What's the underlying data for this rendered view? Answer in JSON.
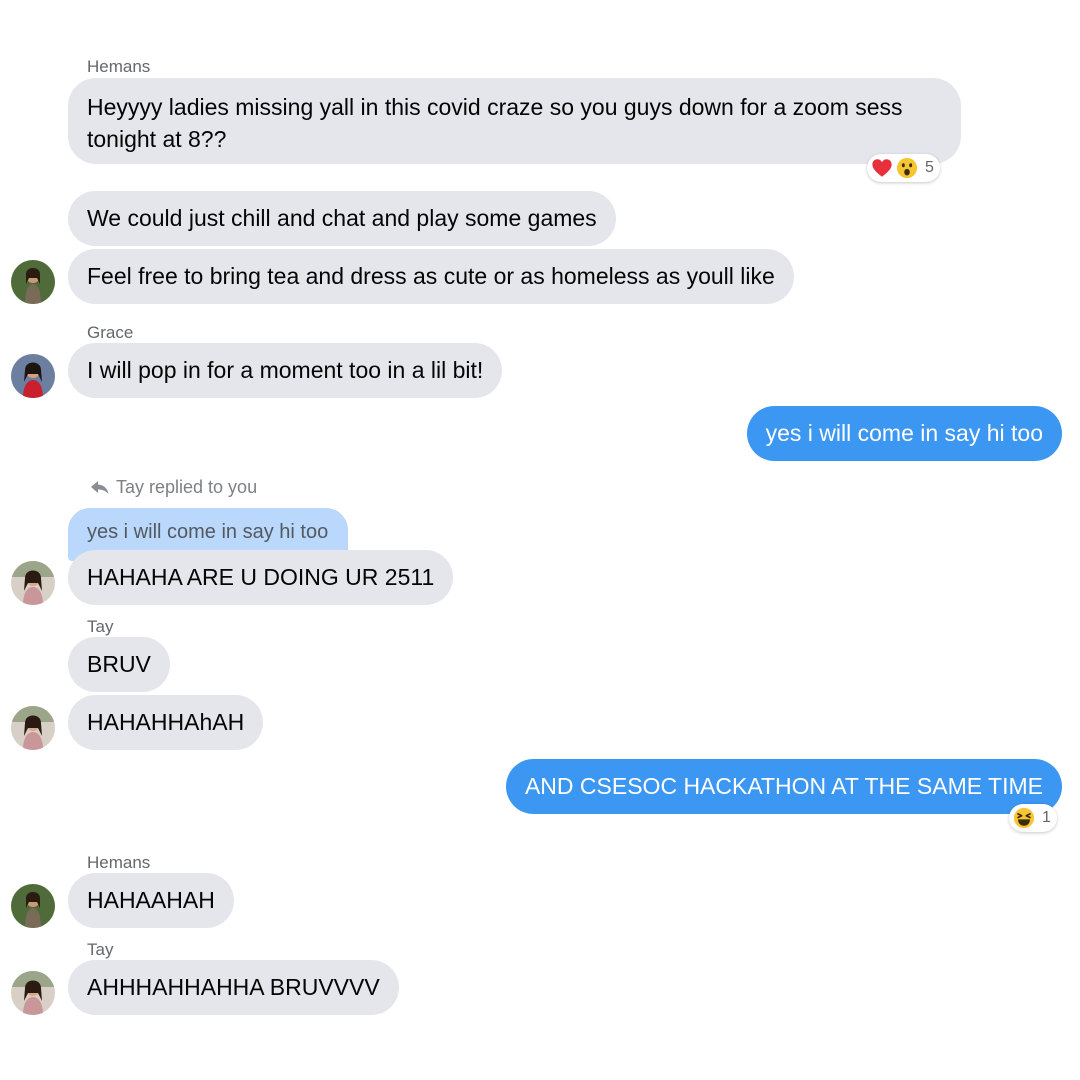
{
  "colors": {
    "incoming_bubble": "#e4e6eb",
    "outgoing_bubble": "#3b97f1",
    "quoted_bubble": "#b9d8fb",
    "sender_name": "#65676b"
  },
  "messages": {
    "m1": {
      "sender": "Hemans",
      "text": "Heyyyy ladies missing yall in this covid craze so you guys down for a zoom sess tonight at 8??"
    },
    "m1_reaction": {
      "icons": [
        "heart-emoji",
        "wow-emoji"
      ],
      "count": "5"
    },
    "m2": {
      "text": "We could just chill and chat and play some games"
    },
    "m3": {
      "text": "Feel free to bring tea and dress as cute or as homeless as youll like"
    },
    "m4": {
      "sender": "Grace",
      "text": "I will pop in for a moment too in a lil bit!"
    },
    "m5": {
      "text": "yes i will come in say hi too"
    },
    "m6": {
      "reply_label": "Tay replied to you",
      "quoted_text": "yes i will come in say hi too",
      "text": "HAHAHA ARE U DOING UR 2511"
    },
    "m7": {
      "sender": "Tay",
      "text": "BRUV"
    },
    "m8": {
      "text": "HAHAHHAhAH"
    },
    "m9": {
      "text": "AND CSESOC HACKATHON AT THE SAME TIME"
    },
    "m9_reaction": {
      "icons": [
        "laughing-emoji"
      ],
      "count": "1"
    },
    "m10": {
      "sender": "Hemans",
      "text": "HAHAAHAH"
    },
    "m11": {
      "sender": "Tay",
      "text": "AHHHAHHAHHA BRUVVVV"
    }
  }
}
